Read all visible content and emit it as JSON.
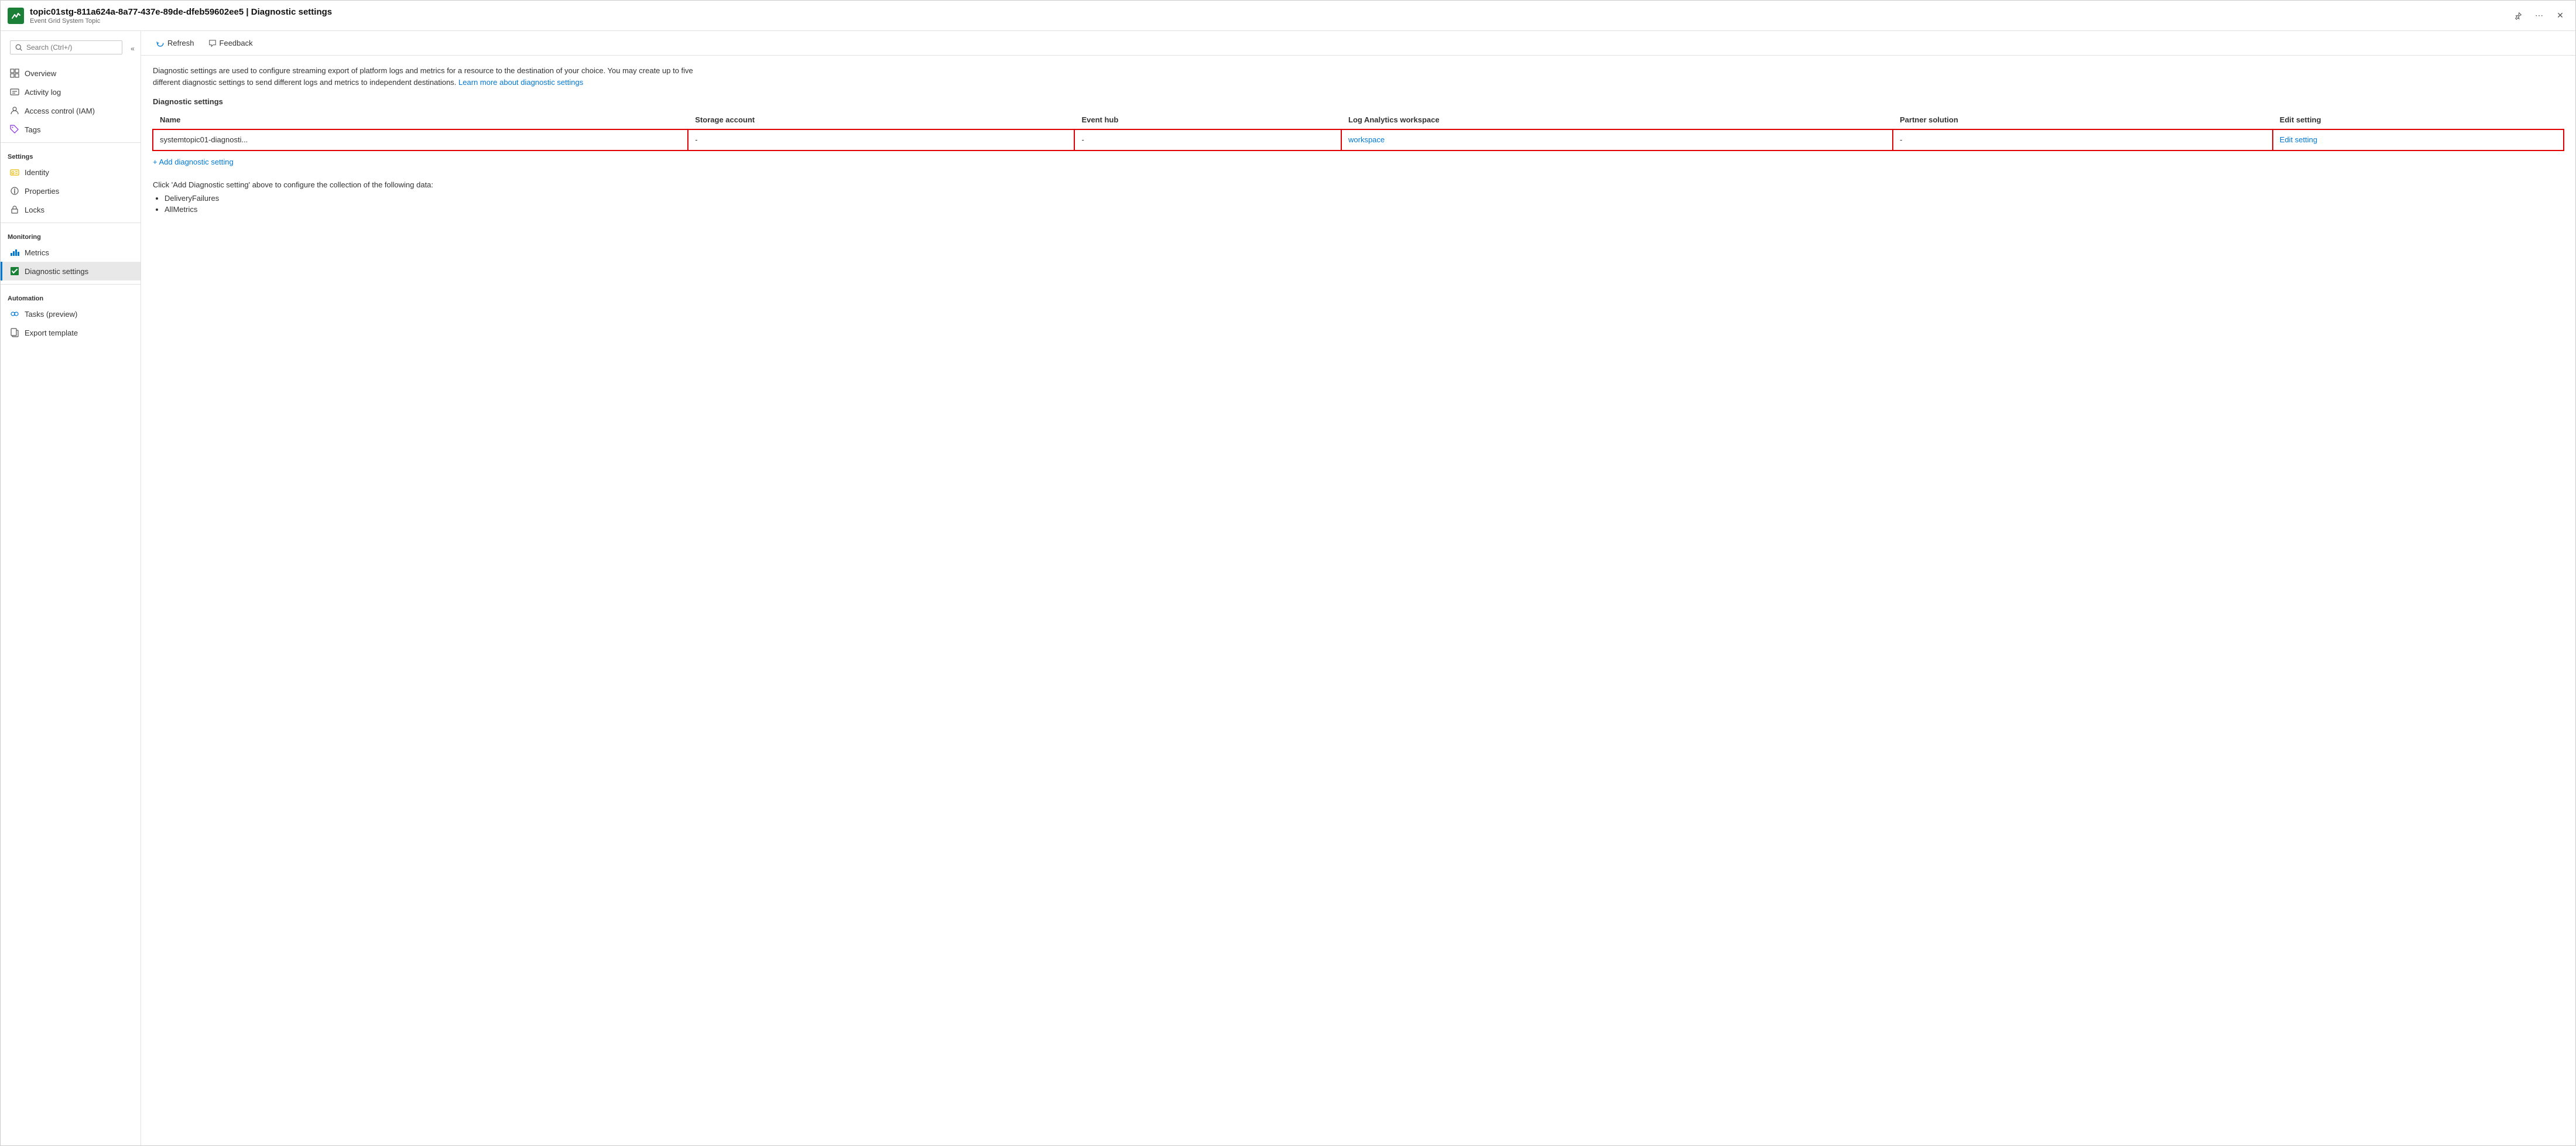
{
  "titleBar": {
    "title": "topic01stg-811a624a-8a77-437e-89de-dfeb59602ee5 | Diagnostic settings",
    "subtitle": "Event Grid System Topic",
    "pinLabel": "Pin",
    "moreLabel": "More",
    "closeLabel": "Close"
  },
  "sidebar": {
    "searchPlaceholder": "Search (Ctrl+/)",
    "collapseLabel": "<<",
    "items": [
      {
        "id": "overview",
        "label": "Overview",
        "icon": "overview"
      },
      {
        "id": "activity-log",
        "label": "Activity log",
        "icon": "activity"
      },
      {
        "id": "access-control",
        "label": "Access control (IAM)",
        "icon": "iam"
      },
      {
        "id": "tags",
        "label": "Tags",
        "icon": "tags"
      },
      {
        "id": "settings-section",
        "label": "Settings",
        "type": "section"
      },
      {
        "id": "identity",
        "label": "Identity",
        "icon": "identity"
      },
      {
        "id": "properties",
        "label": "Properties",
        "icon": "properties"
      },
      {
        "id": "locks",
        "label": "Locks",
        "icon": "locks"
      },
      {
        "id": "monitoring-section",
        "label": "Monitoring",
        "type": "section"
      },
      {
        "id": "metrics",
        "label": "Metrics",
        "icon": "metrics"
      },
      {
        "id": "diagnostic-settings",
        "label": "Diagnostic settings",
        "icon": "diagnostic",
        "active": true
      },
      {
        "id": "automation-section",
        "label": "Automation",
        "type": "section"
      },
      {
        "id": "tasks",
        "label": "Tasks (preview)",
        "icon": "tasks"
      },
      {
        "id": "export-template",
        "label": "Export template",
        "icon": "export"
      }
    ]
  },
  "toolbar": {
    "refreshLabel": "Refresh",
    "feedbackLabel": "Feedback"
  },
  "content": {
    "descriptionText": "Diagnostic settings are used to configure streaming export of platform logs and metrics for a resource to the destination of your choice. You may create up to five different diagnostic settings to send different logs and metrics to independent destinations.",
    "learnMoreText": "Learn more about diagnostic settings",
    "learnMoreUrl": "#",
    "sectionTitle": "Diagnostic settings",
    "tableColumns": [
      "Name",
      "Storage account",
      "Event hub",
      "Log Analytics workspace",
      "Partner solution",
      "Edit setting"
    ],
    "tableRows": [
      {
        "name": "systemtopic01-diagnosti...",
        "storageAccount": "-",
        "eventHub": "-",
        "logAnalyticsWorkspace": "workspace",
        "partnerSolution": "-",
        "editSetting": "Edit setting"
      }
    ],
    "addButtonLabel": "+ Add diagnostic setting",
    "clickInfoText": "Click 'Add Diagnostic setting' above to configure the collection of the following data:",
    "bulletItems": [
      "DeliveryFailures",
      "AllMetrics"
    ]
  }
}
